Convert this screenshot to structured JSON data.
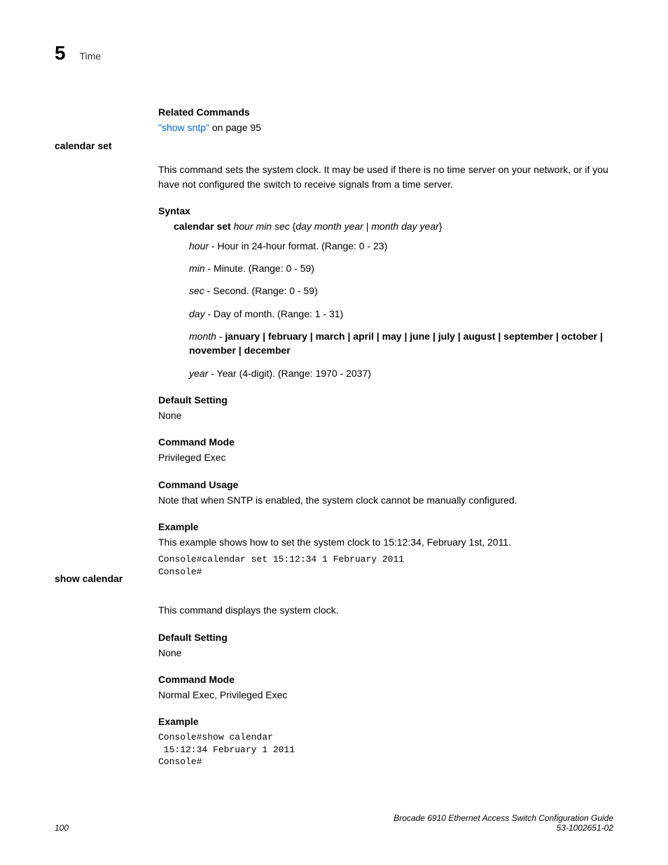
{
  "header": {
    "chapter_number": "5",
    "chapter_title": "Time"
  },
  "related": {
    "heading": "Related Commands",
    "link_text": "\"show sntp\"",
    "link_rest": " on page 95"
  },
  "calendar_set": {
    "label": "calendar set",
    "intro": "This command sets the system clock. It may be used if there is no time server on your network, or if you have not configured the switch to receive signals from a time server.",
    "syntax_heading": "Syntax",
    "syntax_cmd_bold": "calendar set",
    "syntax_cmd_italic1": " hour min sec",
    "syntax_cmd_plain1": " {",
    "syntax_cmd_italic2": "day month year",
    "syntax_cmd_plain2": " | ",
    "syntax_cmd_italic3": "month day year",
    "syntax_cmd_plain3": "}",
    "params": {
      "hour_i": "hour",
      "hour_t": " - Hour in 24-hour format. (Range: 0 - 23)",
      "min_i": "min",
      "min_t": " - Minute. (Range: 0 - 59)",
      "sec_i": "sec",
      "sec_t": " - Second. (Range: 0 - 59)",
      "day_i": "day",
      "day_t": " - Day of month. (Range: 1 - 31)",
      "month_i": "month",
      "month_dash": " - ",
      "month_b": "january | february | march | april | may | june | july | august | september | october | november | december",
      "year_i": "year",
      "year_t": " - Year (4-digit). (Range: 1970 - 2037)"
    },
    "default_heading": "Default Setting",
    "default_value": "None",
    "mode_heading": "Command Mode",
    "mode_value": "Privileged Exec",
    "usage_heading": "Command Usage",
    "usage_text": "Note that when SNTP is enabled, the system clock cannot be manually configured.",
    "example_heading": "Example",
    "example_text": "This example shows how to set the system clock to 15:12:34, February 1st, 2011.",
    "example_console": "Console#calendar set 15:12:34 1 February 2011\nConsole#"
  },
  "show_calendar": {
    "label": "show calendar",
    "intro": "This command displays the system clock.",
    "default_heading": "Default Setting",
    "default_value": "None",
    "mode_heading": "Command Mode",
    "mode_value": "Normal Exec, Privileged Exec",
    "example_heading": "Example",
    "example_console": "Console#show calendar\n 15:12:34 February 1 2011\nConsole#"
  },
  "footer": {
    "page": "100",
    "title": "Brocade 6910 Ethernet Access Switch Configuration Guide",
    "docnum": "53-1002651-02"
  }
}
